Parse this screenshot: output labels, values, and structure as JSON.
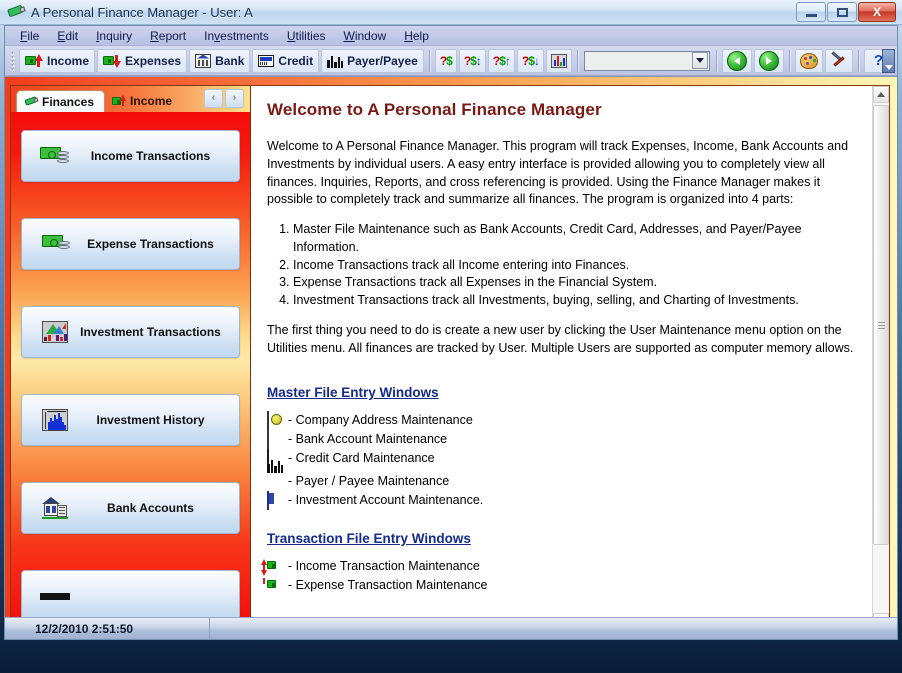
{
  "window": {
    "title": "A Personal Finance Manager - User: A",
    "title_icon": "finance-pen-icon",
    "minimize_label": "Minimize",
    "maximize_label": "Restore",
    "close_label": "X"
  },
  "menu": {
    "items": [
      {
        "label": "File",
        "accel": "F"
      },
      {
        "label": "Edit",
        "accel": "E"
      },
      {
        "label": "Inquiry",
        "accel": "I"
      },
      {
        "label": "Report",
        "accel": "R"
      },
      {
        "label": "Investments",
        "accel": "v"
      },
      {
        "label": "Utilities",
        "accel": "U"
      },
      {
        "label": "Window",
        "accel": "W"
      },
      {
        "label": "Help",
        "accel": "H"
      }
    ]
  },
  "toolbar": {
    "buttons": [
      {
        "label": "Income",
        "icon": "money-up-icon"
      },
      {
        "label": "Expenses",
        "icon": "money-down-icon"
      },
      {
        "label": "Bank",
        "icon": "bank-icon"
      },
      {
        "label": "Credit",
        "icon": "credit-card-icon"
      },
      {
        "label": "Payer/Payee",
        "icon": "city-skyline-icon"
      }
    ],
    "query_buttons": [
      {
        "label": "?$",
        "icon": "query-dollar-icon"
      },
      {
        "label": "?$↕",
        "icon": "query-dollar-up-icon"
      },
      {
        "label": "?$↑",
        "icon": "query-dollar-in-icon"
      },
      {
        "label": "?$↓",
        "icon": "query-dollar-out-icon"
      }
    ],
    "chart_button": {
      "label": "",
      "icon": "bar-chart-icon"
    },
    "combo": {
      "value": "",
      "placeholder": ""
    },
    "nav_back": {
      "icon": "green-back-arrow-icon"
    },
    "nav_forward": {
      "icon": "green-forward-arrow-icon"
    },
    "palette_button": {
      "icon": "palette-icon"
    },
    "tools_button": {
      "icon": "tools-icon"
    },
    "help_button": {
      "label": "?",
      "icon": "help-question-icon"
    },
    "overflow": {
      "icon": "toolbar-overflow-icon"
    }
  },
  "nav_pane": {
    "tabs": [
      {
        "label": "Finances",
        "icon": "finance-pen-icon",
        "active": true
      },
      {
        "label": "Income",
        "icon": "money-up-icon",
        "active": false
      }
    ],
    "tab_prev": "‹",
    "tab_next": "›",
    "buttons": [
      {
        "label": "Income Transactions",
        "icon": "cash-hand-icon"
      },
      {
        "label": "Expense Transactions",
        "icon": "cash-coins-icon"
      },
      {
        "label": "Investment Transactions",
        "icon": "investment-chart-icon"
      },
      {
        "label": "Investment History",
        "icon": "history-chart-icon"
      },
      {
        "label": "Bank Accounts",
        "icon": "bank-building-icon"
      },
      {
        "label": "",
        "icon": "partial-icon"
      }
    ]
  },
  "document": {
    "heading": "Welcome to A Personal Finance Manager",
    "intro": "Welcome to A Personal Finance Manager. This program will track Expenses, Income, Bank Accounts and Investments by individual users. A easy entry interface is provided allowing you to completely view all finances. Inquiries, Reports, and cross referencing is provided. Using the Finance Manager makes it possible to completely track and summarize all finances. The program is organized into 4 parts:",
    "parts": [
      "Master File Maintenance such as Bank Accounts, Credit Card, Addresses, and Payer/Payee Information.",
      "Income Transactions track all Income entering into Finances.",
      "Expense Transactions track all Expenses in the Financial System.",
      "Investment Transactions track all Investments, buying, selling, and Charting of Investments."
    ],
    "user_note": "The first thing you need to do is create a new user by clicking the User Maintenance menu option on the Utilities menu. All finances are tracked by User. Multiple Users are supported as computer memory allows.",
    "master_heading": "Master File Entry Windows",
    "master_items": [
      {
        "text": "- Company Address Maintenance",
        "icon": "globe-address-icon"
      },
      {
        "text": "- Bank Account Maintenance",
        "icon": "bank-icon"
      },
      {
        "text": "- Credit Card Maintenance",
        "icon": "credit-card-icon"
      },
      {
        "text": "- Payer / Payee Maintenance",
        "icon": "city-skyline-icon"
      },
      {
        "text": "- Investment Account Maintenance.",
        "icon": "investment-account-icon"
      }
    ],
    "transaction_heading": "Transaction File Entry Windows",
    "transaction_items": [
      {
        "text": "- Income Transaction Maintenance",
        "icon": "money-up-icon"
      },
      {
        "text": "- Expense Transaction Maintenance",
        "icon": "money-down-icon"
      }
    ]
  },
  "scrollbar": {
    "up_arrow": "▲",
    "down_arrow": "▼"
  },
  "status_bar": {
    "datetime": "12/2/2010 2:51:50"
  },
  "colors": {
    "heading": "#7a1a16",
    "link_heading": "#142a8c",
    "nav_red": "#f50c0c",
    "nav_yellow": "#fde9a8",
    "title_text": "#0b2a50"
  }
}
